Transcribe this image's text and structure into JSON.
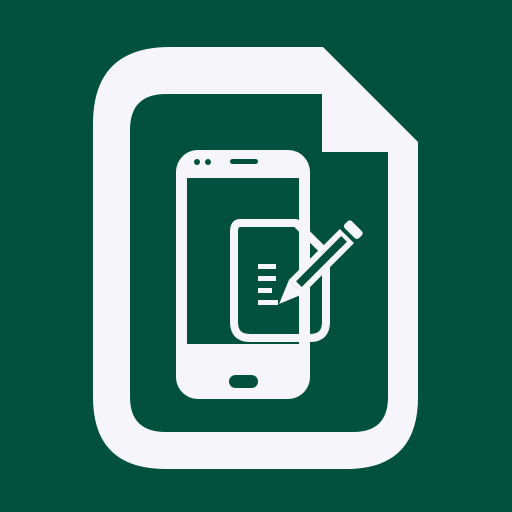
{
  "icon": {
    "name": "mobile-document-edit-icon",
    "colors": {
      "background": "#02513F",
      "foreground": "#F6F6FA"
    }
  }
}
